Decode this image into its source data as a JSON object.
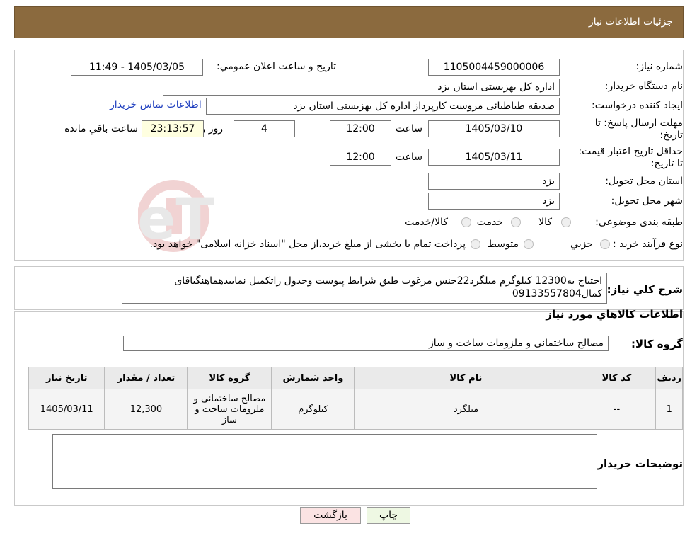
{
  "header": {
    "title": "جزئیات اطلاعات نیاز"
  },
  "form": {
    "need_number_label": "شماره نیاز:",
    "need_number": "1105004459000006",
    "announce_label": "تاريخ و ساعت اعلان عمومي:",
    "announce_value": "1405/03/05 - 11:49",
    "buyer_org_label": "نام دستگاه خريدار:",
    "buyer_org": "اداره کل بهزیستی استان یزد",
    "creator_label": "ايجاد کننده درخواست:",
    "creator": "صدیقه طباطبائی مروست کارپرداز اداره کل بهزیستی استان یزد",
    "contact_link": "اطلاعات تماس خريدار",
    "deadline_label": "مهلت ارسال پاسخ: تا تاريخ:",
    "deadline_date": "1405/03/10",
    "time_label": "ساعت",
    "deadline_time": "12:00",
    "days": "4",
    "days_label": "روز و",
    "remaining": "23:13:57",
    "remaining_label": "ساعت باقي مانده",
    "validity_label": "حداقل تاريخ اعتبار قيمت: تا تاريخ:",
    "validity_date": "1405/03/11",
    "validity_time": "12:00",
    "province_label": "استان محل تحويل:",
    "province": "یزد",
    "city_label": "شهر محل تحويل:",
    "city": "یزد",
    "category_label": "طبقه بندی موضوعی:",
    "cat_options": [
      "کالا",
      "خدمت",
      "کالا/خدمت"
    ],
    "process_label": "نوع فرآيند خريد :",
    "process_options": [
      "جزيي",
      "متوسط"
    ],
    "process_note": "پرداخت تمام یا بخشی از مبلغ خرید،از محل \"اسناد خزانه اسلامی\" خواهد بود."
  },
  "description": {
    "label": "شرح کلي نياز:",
    "text": "احتیاج به12300 کیلوگرم میلگرد22جنس مرغوب طبق شرایط پیوست وجدول راتکمیل نماییدهماهنگیاقای کمال09133557804"
  },
  "goods": {
    "section_title": "اطلاعات کالاهاي مورد نياز",
    "group_label": "گروه کالا:",
    "group_value": "مصالح ساختمانی و ملزومات ساخت و ساز",
    "columns": [
      "رديف",
      "کد کالا",
      "نام کالا",
      "واحد شمارش",
      "گروه کالا",
      "تعداد / مقدار",
      "تاريخ نياز"
    ],
    "rows": [
      [
        "1",
        "--",
        "میلگرد",
        "کیلوگرم",
        "مصالح ساختمانی و ملزومات ساخت و ساز",
        "12,300",
        "1405/03/11"
      ]
    ]
  },
  "buyer_notes": {
    "label": "توضيحات خريدار:"
  },
  "buttons": {
    "print": "چاپ",
    "back": "بازگشت"
  },
  "watermark": {
    "text": "AriaTender.neT"
  }
}
